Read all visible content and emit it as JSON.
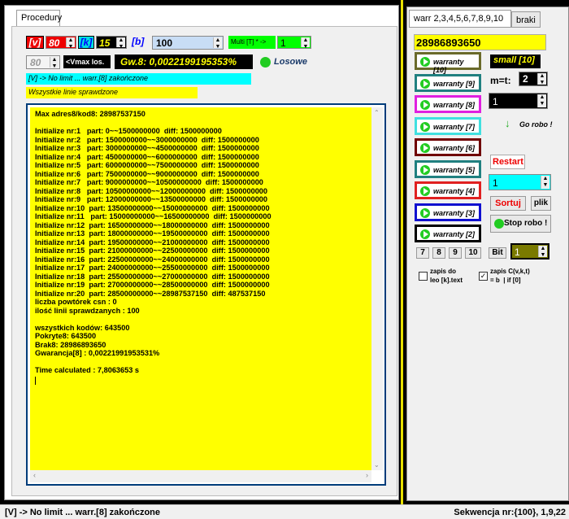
{
  "tabs": {
    "procedury": "Procedury"
  },
  "controls": {
    "v_label": "[v]",
    "v_value": "80",
    "k_label": "[k]",
    "k_value": "15",
    "b_label": "[b]",
    "b_value": "100",
    "multi_label": "Multi [T] * ->",
    "multi_value": "1",
    "vmax_value": "80",
    "vmax_label": "<Vmax los.",
    "gw_label": "Gw.8: 0,0022199195353%",
    "losowe_label": "Losowe"
  },
  "banners": {
    "cyan": "[V] -> No limit ... warr.[8] zakończone",
    "yellow": "Wszystkie linie sprawdzone"
  },
  "log": {
    "lines": [
      "Max adres8/kod8: 28987537150",
      "",
      "Initialize nr:1   part: 0~~1500000000  diff: 1500000000",
      "Initialize nr:2   part: 1500000000~~3000000000  diff: 1500000000",
      "Initialize nr:3   part: 3000000000~~4500000000  diff: 1500000000",
      "Initialize nr:4   part: 4500000000~~6000000000  diff: 1500000000",
      "Initialize nr:5   part: 6000000000~~7500000000  diff: 1500000000",
      "Initialize nr:6   part: 7500000000~~9000000000  diff: 1500000000",
      "Initialize nr:7   part: 9000000000~~10500000000  diff: 1500000000",
      "Initialize nr:8   part: 10500000000~~12000000000  diff: 1500000000",
      "Initialize nr:9   part: 12000000000~~13500000000  diff: 1500000000",
      "Initialize nr:10  part: 13500000000~~15000000000  diff: 1500000000",
      "Initialize nr:11   part: 15000000000~~16500000000  diff: 1500000000",
      "Initialize nr:12  part: 16500000000~~18000000000  diff: 1500000000",
      "Initialize nr:13  part: 18000000000~~19500000000  diff: 1500000000",
      "Initialize nr:14  part: 19500000000~~21000000000  diff: 1500000000",
      "Initialize nr:15  part: 21000000000~~22500000000  diff: 1500000000",
      "Initialize nr:16  part: 22500000000~~24000000000  diff: 1500000000",
      "Initialize nr:17  part: 24000000000~~25500000000  diff: 1500000000",
      "Initialize nr:18  part: 25500000000~~27000000000  diff: 1500000000",
      "Initialize nr:19  part: 27000000000~~28500000000  diff: 1500000000",
      "Initialize nr:20  part: 28500000000~~28987537150  diff: 487537150",
      "liczba powtórek csn : 0",
      "ilość linii sprawdzanych : 100",
      "",
      "wszystkich kodów: 643500",
      "Pokryte8: 643500",
      "Brak8: 28986893650",
      "Gwarancja[8] : 0,00221991953531%",
      "",
      "Time calculated : 7,8063653 s"
    ]
  },
  "right": {
    "tab_warr": "warr 2,3,4,5,6,7,8,9,10",
    "tab_braki": "braki",
    "big_number": "28986893650",
    "small_label": "small [10]",
    "mt_label": "m=t:",
    "mt_value": "2",
    "spin1_value": "1",
    "go_robo": "Go robo !",
    "restart": "Restart",
    "cyan_spin_value": "1",
    "sortuj": "Sortuj",
    "plik": "plik",
    "stop_robo": "Stop robo  !",
    "nums": [
      "7",
      "8",
      "9",
      "10"
    ],
    "bit": "Bit",
    "olive_value": "1",
    "chk1": "zapis do\nleo [k].text",
    "chk2": "zapis C(v,k,t)\n= b  | if [0]",
    "warr_buttons": [
      {
        "label": "warranty [10]",
        "color": "#6a6a2a"
      },
      {
        "label": "warranty [9]",
        "color": "#208080"
      },
      {
        "label": "warranty [8]",
        "color": "#e020e0"
      },
      {
        "label": "warranty [7]",
        "color": "#40e0e0"
      },
      {
        "label": "warranty [6]",
        "color": "#700000"
      },
      {
        "label": "warranty [5]",
        "color": "#208080"
      },
      {
        "label": "warranty [4]",
        "color": "#e02020"
      },
      {
        "label": "warranty [3]",
        "color": "#1010d0"
      },
      {
        "label": "warranty [2]",
        "color": "#000000"
      }
    ]
  },
  "status": {
    "left": "[V] -> No limit ... warr.[8] zakończone",
    "right": "Sekwencja nr:{100}, 1,9,22"
  }
}
